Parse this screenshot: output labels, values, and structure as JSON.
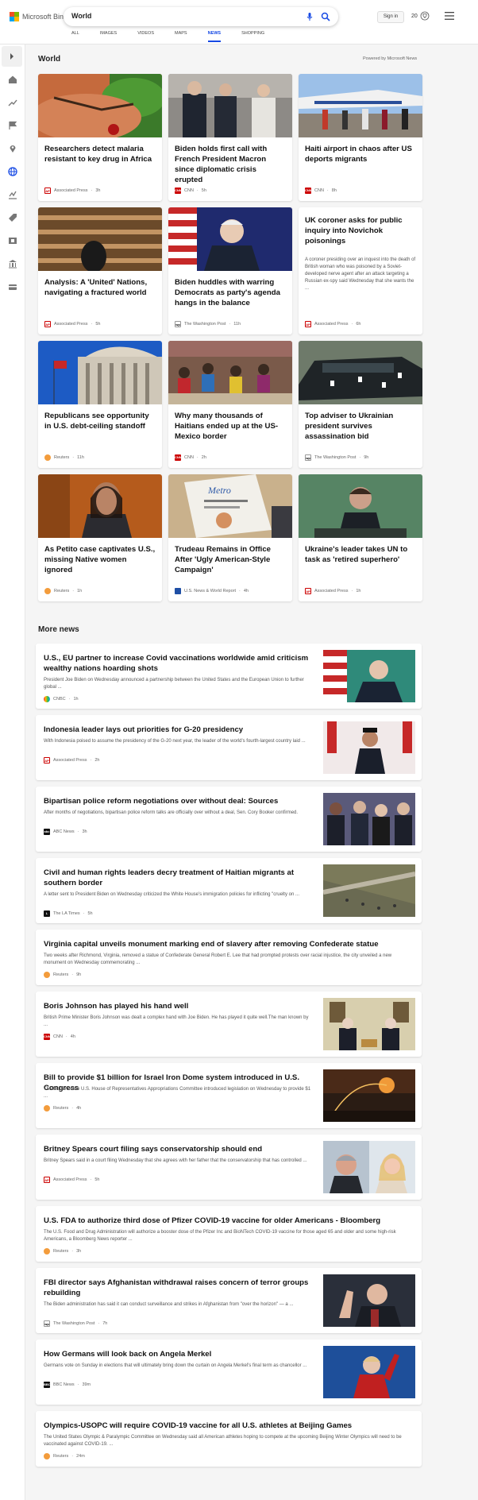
{
  "header": {
    "brand": "Microsoft Bing",
    "search_value": "World",
    "signin_label": "Sign in",
    "rewards_count": "20",
    "tabs": [
      "ALL",
      "IMAGES",
      "VIDEOS",
      "MAPS",
      "NEWS",
      "SHOPPING"
    ],
    "active_tab": "NEWS"
  },
  "world": {
    "title": "World",
    "powered_by": "Powered by Microsoft News",
    "cards": [
      {
        "title": "Researchers detect malaria resistant to key drug in Africa",
        "source": "Associated Press",
        "time": "3h"
      },
      {
        "title": "Biden holds first call with French President Macron since diplomatic crisis erupted",
        "source": "CNN",
        "time": "5h"
      },
      {
        "title": "Haiti airport in chaos after US deports migrants",
        "source": "CNN",
        "time": "8h"
      },
      {
        "title": "Analysis: A 'United' Nations, navigating a fractured world",
        "source": "Associated Press",
        "time": "5h"
      },
      {
        "title": "Biden huddles with warring Democrats as party's agenda hangs in the balance",
        "source": "The Washington Post",
        "time": "11h"
      },
      {
        "title": "UK coroner asks for public inquiry into Novichok poisonings",
        "summary": "A coroner presiding over an inquest into the death of British woman who was poisoned by a Soviet-developed nerve agent after an attack targeting a Russian ex-spy said Wednesday that she wants the ...",
        "source": "Associated Press",
        "time": "6h"
      },
      {
        "title": "Republicans see opportunity in U.S. debt-ceiling standoff",
        "source": "Reuters",
        "time": "11h"
      },
      {
        "title": "Why many thousands of Haitians ended up at the US-Mexico border",
        "source": "CNN",
        "time": "2h"
      },
      {
        "title": "Top adviser to Ukrainian president survives assassination bid",
        "source": "The Washington Post",
        "time": "9h"
      },
      {
        "title": "As Petito case captivates U.S., missing Native women ignored",
        "source": "Reuters",
        "time": "1h"
      },
      {
        "title": "Trudeau Remains in Office After 'Ugly American-Style Campaign'",
        "source": "U.S. News & World Report",
        "time": "4h"
      },
      {
        "title": "Ukraine's leader takes UN to task as 'retired superhero'",
        "source": "Associated Press",
        "time": "1h"
      }
    ]
  },
  "more_news": {
    "title": "More news",
    "items": [
      {
        "title": "U.S., EU partner to increase Covid vaccinations worldwide amid criticism wealthy nations hoarding shots",
        "desc": "President Joe Biden on Wednesday announced a partnership between the United States and the European Union to further global ...",
        "source": "CNBC",
        "time": "1h"
      },
      {
        "title": "Indonesia leader lays out priorities for G-20 presidency",
        "desc": "With Indonesia poised to assume the presidency of the G-20 next year, the leader of the world's fourth-largest country laid ...",
        "source": "Associated Press",
        "time": "2h"
      },
      {
        "title": "Bipartisan police reform negotiations over without deal: Sources",
        "desc": "After months of negotiations, bipartisan police reform talks are officially over without a deal, Sen. Cory Booker confirmed.",
        "source": "ABC News",
        "time": "3h"
      },
      {
        "title": "Civil and human rights leaders decry treatment of Haitian migrants at southern border",
        "desc": "A letter sent to President Biden on Wednesday criticized the White House's immigration policies for inflicting \"cruelty on ...",
        "source": "The LA Times",
        "time": "5h"
      },
      {
        "title": "Virginia capital unveils monument marking end of slavery after removing Confederate statue",
        "desc": "Two weeks after Richmond, Virginia, removed a statue of Confederate General Robert E. Lee that had prompted protests over racial injustice, the city unveiled a new monument on Wednesday commemorating ...",
        "source": "Reuters",
        "time": "9h"
      },
      {
        "title": "Boris Johnson has played his hand well",
        "desc": "British Prime Minister Boris Johnson was dealt a complex hand with Joe Biden. He has played it quite well.The man known by ...",
        "source": "CNN",
        "time": "4h"
      },
      {
        "title": "Bill to provide $1 billion for Israel Iron Dome system introduced in U.S. Congress",
        "desc": "The leader of the U.S. House of Representatives Appropriations Committee introduced legislation on Wednesday to provide $1 ...",
        "source": "Reuters",
        "time": "4h"
      },
      {
        "title": "Britney Spears court filing says conservatorship should end",
        "desc": "Britney Spears said in a court filing Wednesday that she agrees with her father that the conservatorship that has controlled ...",
        "source": "Associated Press",
        "time": "5h"
      },
      {
        "title": "U.S. FDA to authorize third dose of Pfizer COVID-19 vaccine for older Americans - Bloomberg",
        "desc": "The U.S. Food and Drug Administration will authorize a booster dose of the Pfizer Inc and BioNTech COVID-19 vaccine for those aged 65 and older and some high-risk Americans, a Bloomberg News reporter ...",
        "source": "Reuters",
        "time": "3h"
      },
      {
        "title": "FBI director says Afghanistan withdrawal raises concern of terror groups rebuilding",
        "desc": "The Biden administration has said it can conduct surveillance and strikes in Afghanistan from \"over the horizon\" — a ...",
        "source": "The Washington Post",
        "time": "7h"
      },
      {
        "title": "How Germans will look back on Angela Merkel",
        "desc": "Germans vote on Sunday in elections that will ultimately bring down the curtain on Angela Merkel's final term as chancellor ...",
        "source": "BBC News",
        "time": "39m"
      },
      {
        "title": "Olympics-USOPC will require COVID-19 vaccine for all U.S. athletes at Beijing Games",
        "desc": "The United States Olympic & Paralympic Committee on Wednesday said all American athletes hoping to compete at the upcoming Beijing Winter Olympics will need to be vaccinated against COVID-19. ...",
        "source": "Reuters",
        "time": "24m"
      }
    ]
  }
}
